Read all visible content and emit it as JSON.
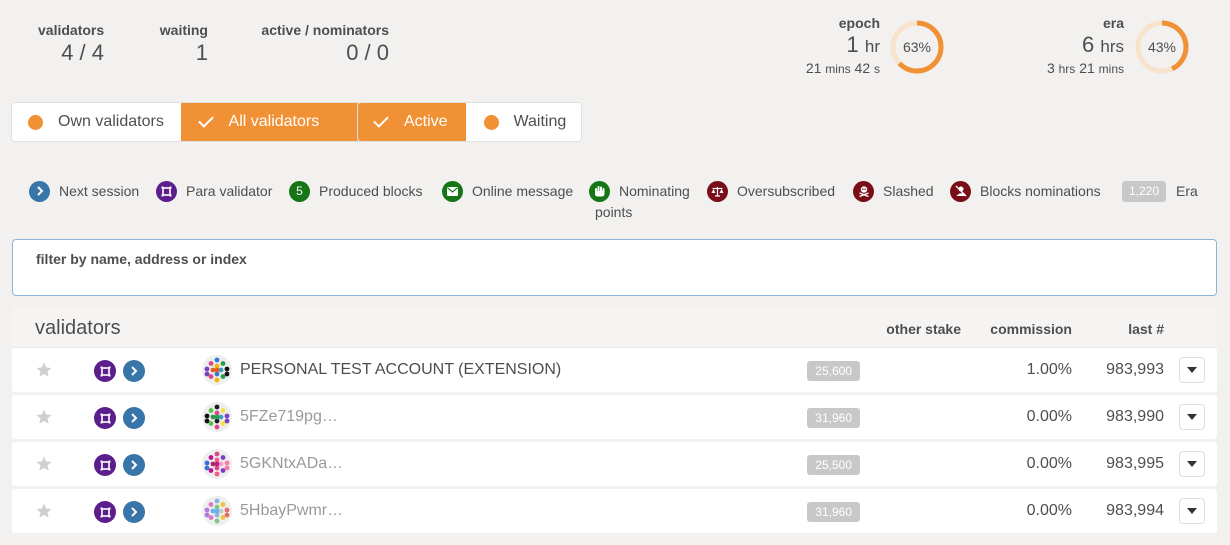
{
  "summary": {
    "validators": {
      "label": "validators",
      "value": "4 / 4"
    },
    "waiting": {
      "label": "waiting",
      "value": "1"
    },
    "active_nominators": {
      "label": "active / nominators",
      "value": "0 / 0"
    },
    "epoch": {
      "label": "epoch",
      "big_num": "1",
      "big_unit": "hr",
      "sub_a": "21",
      "sub_a_unit": "mins",
      "sub_b": "42",
      "sub_b_unit": "s",
      "percent": 63,
      "percent_label": "63%"
    },
    "era": {
      "label": "era",
      "big_num": "6",
      "big_unit": "hrs",
      "sub_a": "3",
      "sub_a_unit": "hrs",
      "sub_b": "21",
      "sub_b_unit": "mins",
      "percent": 43,
      "percent_label": "43%"
    }
  },
  "toggles": {
    "ownership": [
      {
        "label": "Own validators",
        "selected": false
      },
      {
        "label": "All validators",
        "selected": true
      }
    ],
    "status": [
      {
        "label": "Active",
        "selected": true
      },
      {
        "label": "Waiting",
        "selected": false
      }
    ]
  },
  "legend": {
    "next_session": "Next session",
    "para_validator": "Para validator",
    "produced_blocks_count": "5",
    "produced_blocks": "Produced blocks",
    "online_message": "Online message",
    "nominating_line1": "Nominating",
    "nominating_line2": "points",
    "oversubscribed": "Oversubscribed",
    "slashed": "Slashed",
    "blocks_nominations": "Blocks nominations",
    "era_badge": "1,220",
    "era_label": "Era"
  },
  "filter": {
    "label": "filter by name, address or index",
    "value": "",
    "placeholder": ""
  },
  "table": {
    "title": "validators",
    "headers": {
      "other_stake": "other stake",
      "commission": "commission",
      "last": "last #"
    },
    "rows": [
      {
        "name": "PERSONAL TEST ACCOUNT (EXTENSION)",
        "is_address": false,
        "stake": "25,600",
        "commission": "1.00%",
        "last": "983,993"
      },
      {
        "name": "5FZe719pg…",
        "is_address": true,
        "stake": "31,960",
        "commission": "0.00%",
        "last": "983,990"
      },
      {
        "name": "5GKNtxADa…",
        "is_address": true,
        "stake": "25,500",
        "commission": "0.00%",
        "last": "983,995"
      },
      {
        "name": "5HbayPwmr…",
        "is_address": true,
        "stake": "31,960",
        "commission": "0.00%",
        "last": "983,994"
      }
    ]
  },
  "colors": {
    "accent": "#f19135",
    "ring_track": "#f7e2cc",
    "next_session": "#3875a8",
    "para_validator": "#5b1e8c",
    "produced_blocks": "#167516",
    "danger": "#7a0e18",
    "badge_gray": "#c8c8c8"
  }
}
